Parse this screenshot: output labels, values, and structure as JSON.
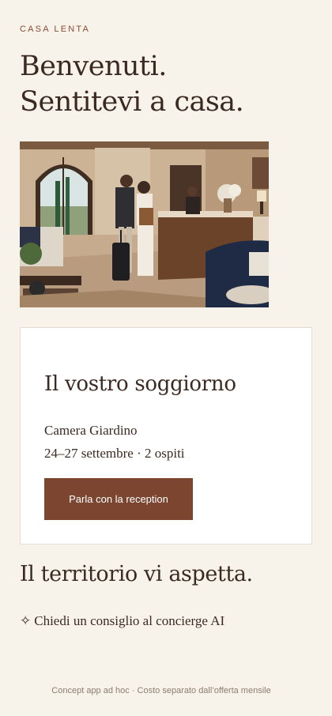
{
  "brand": "CASA LENTA",
  "hero": {
    "line1": "Benvenuti.",
    "line2": "Sentitevi a casa."
  },
  "stay": {
    "title": "Il vostro soggiorno",
    "room": "Camera Giardino",
    "dates": "24–27 settembre · 2 ospiti",
    "button_label": "Parla con la reception"
  },
  "territory": {
    "title": "Il territorio vi aspetta."
  },
  "concierge": {
    "icon": "sparkle-icon",
    "glyph": "✧",
    "label": "Chiedi un consiglio al concierge AI"
  },
  "footer": "Concept app ad hoc · Costo separato dall’offerta mensile",
  "colors": {
    "background": "#f8f3ea",
    "accent": "#7b4530",
    "text": "#3b2a22",
    "brand": "#8a4b32",
    "muted": "#8c7d70"
  }
}
